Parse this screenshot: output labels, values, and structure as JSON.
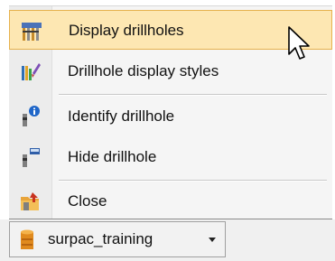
{
  "menu": {
    "items": [
      {
        "label": "Display drillholes",
        "icon": "drillholes-grid-icon",
        "highlighted": true
      },
      {
        "label": "Drillhole display styles",
        "icon": "drillhole-style-brush-icon",
        "highlighted": false
      },
      {
        "label": "Identify drillhole",
        "icon": "identify-drillhole-info-icon",
        "highlighted": false
      },
      {
        "label": "Hide drillhole",
        "icon": "hide-drillhole-icon",
        "highlighted": false
      },
      {
        "label": "Close",
        "icon": "close-folder-icon",
        "highlighted": false
      }
    ]
  },
  "dropdown": {
    "label": "surpac_training",
    "icon": "database-cylinder-icon"
  },
  "colors": {
    "highlight_fill": "#fde7b2",
    "highlight_border": "#e6b24e",
    "icon_column": "#ececec"
  }
}
